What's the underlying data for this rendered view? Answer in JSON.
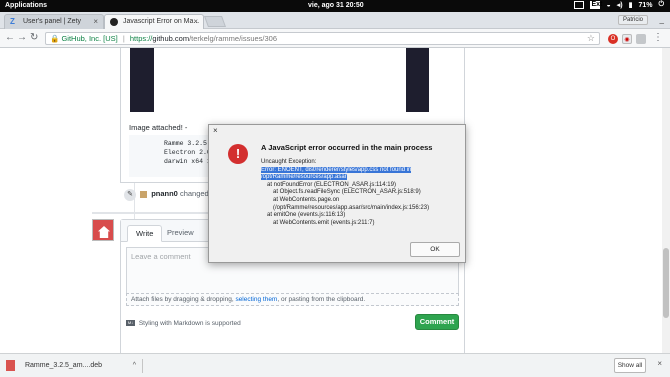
{
  "system": {
    "apps_label": "Applications",
    "clock": "vie, ago 31   20:50",
    "battery": "71%",
    "tray_badge": "Ext"
  },
  "tabs": [
    {
      "label": "User's panel | Zety",
      "close": "×"
    },
    {
      "label": "Javascript Error on Ma...",
      "close": "×"
    }
  ],
  "profile_label": "Patricio",
  "address": {
    "lock": "🔒",
    "company": "GitHub, Inc. [US]",
    "separator": "|",
    "scheme": "https://",
    "host": "github.com",
    "path": "/terkelg/ramme/issues/306",
    "star": "☆"
  },
  "issue": {
    "image_attached": "Image attached! -",
    "code_lines": [
      "Ramme 3.2.5",
      "Electron 2.0.",
      "darwin x64 18"
    ],
    "event_user": "pnann0",
    "event_text": "changed t",
    "editor": {
      "tab_write": "Write",
      "tab_preview": "Preview",
      "placeholder": "Leave a comment",
      "attach_before": "Attach files by dragging & dropping, ",
      "attach_link": "selecting them",
      "attach_after": ", or pasting from the clipboard.",
      "md_badge": "M↓",
      "markdown_note": "Styling with Markdown is supported",
      "comment_button": "Comment"
    }
  },
  "dialog": {
    "close": "×",
    "icon": "!",
    "title": "A JavaScript error occurred in the main process",
    "exception_label": "Uncaught Exception:",
    "selected_error": "Error: ENOENT, dist/renderer/styles/app.css not found in /opt/Ramme/resources/app.asar",
    "stack": [
      "at notFoundError (ELECTRON_ASAR.js:114:19)",
      "at Object.fs.readFileSync (ELECTRON_ASAR.js:518:9)",
      "at WebContents.page.on (/opt/Ramme/resources/app.asar/src/main/index.js:156:23)",
      "at emitOne (events.js:116:13)",
      "at WebContents.emit (events.js:211:7)"
    ],
    "ok_button": "OK"
  },
  "downloads": {
    "file_name": "Ramme_3.2.5_am....deb",
    "caret": "^",
    "show_all": "Show all",
    "close": "×"
  }
}
